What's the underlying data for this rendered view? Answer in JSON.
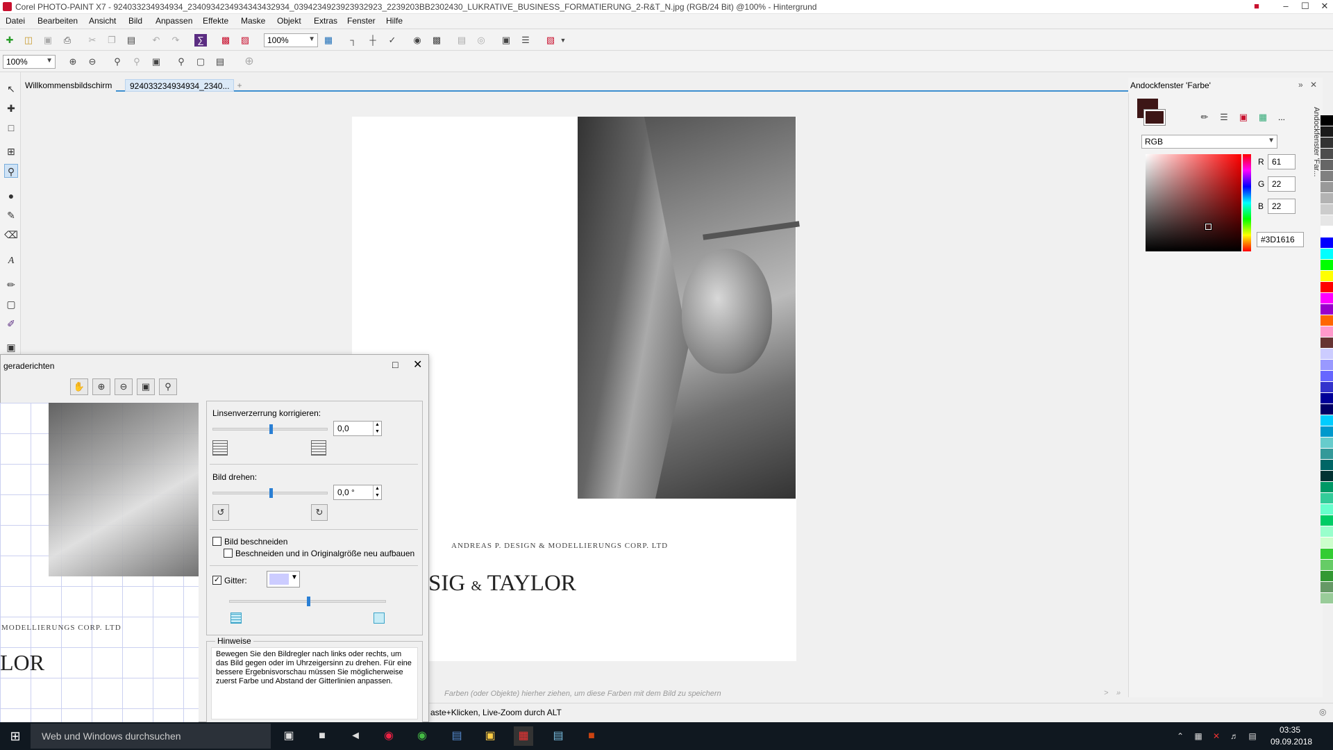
{
  "window": {
    "title": "Corel PHOTO-PAINT X7 - 924033234934934_2340934234934343432934_0394234923923932923_2239203BB2302430_LUKRATIVE_BUSINESS_FORMATIERUNG_2-R&T_N.jpg (RGB/24 Bit) @100% - Hintergrund",
    "min": "–",
    "max": "☐",
    "close": "✕"
  },
  "menu": [
    "Datei",
    "Bearbeiten",
    "Ansicht",
    "Bild",
    "Anpassen",
    "Effekte",
    "Maske",
    "Objekt",
    "Extras",
    "Fenster",
    "Hilfe"
  ],
  "toolbar": {
    "zoom_value": "100%"
  },
  "toolbar2": {
    "zoom_value": "100%"
  },
  "tabs": [
    {
      "label": "Willkommensbildschirm"
    },
    {
      "label": "924033234934934_2340..."
    }
  ],
  "canvas": {
    "company_line": "ANDREAS P. DESIGN & MODELLIERUNGS CORP. LTD",
    "logo_text": "SIG",
    "logo_amp": "&",
    "logo_name": "TAYLOR"
  },
  "dock": {
    "title": "Andockfenster 'Farbe'",
    "side_tab": "Andockfenster 'Far...",
    "model": "RGB",
    "r_label": "R",
    "r_value": "61",
    "g_label": "G",
    "g_value": "22",
    "b_label": "B",
    "b_value": "22",
    "hex": "#3D1616",
    "more": "...",
    "color": "#3D1616"
  },
  "palette": [
    "#000000",
    "#1a1a1a",
    "#333333",
    "#4d4d4d",
    "#666666",
    "#808080",
    "#999999",
    "#b3b3b3",
    "#cccccc",
    "#e6e6e6",
    "#ffffff",
    "#0000ff",
    "#00ffff",
    "#00ff00",
    "#ffff00",
    "#ff0000",
    "#ff00ff",
    "#9900cc",
    "#ff6600",
    "#ff99cc",
    "#663333",
    "#ccccff",
    "#9999ff",
    "#6666ff",
    "#3333cc",
    "#000099",
    "#000066",
    "#00ccff",
    "#0099cc",
    "#66cccc",
    "#339999",
    "#006666",
    "#003333",
    "#009966",
    "#33cc99",
    "#66ffcc",
    "#00cc66",
    "#99ffcc",
    "#ccffcc",
    "#33cc33",
    "#66cc66",
    "#339933",
    "#669966",
    "#99cc99"
  ],
  "swatch_hint": "Farben (oder Objekte) hierher ziehen, um diese Farben mit dem Bild zu speichern",
  "status": {
    "hint": "aste+Klicken, Live-Zoom durch ALT"
  },
  "dialog": {
    "title": "geraderichten",
    "lens_label": "Linsenverzerrung korrigieren:",
    "lens_value": "0,0",
    "lens_slider": 0.5,
    "rotate_label": "Bild drehen:",
    "rotate_value": "0,0 °",
    "rotate_slider": 0.5,
    "crop_label": "Bild beschneiden",
    "crop_checked": false,
    "crop_orig_label": "Beschneiden und in Originalgröße neu aufbauen",
    "crop_orig_checked": false,
    "grid_label": "Gitter:",
    "grid_checked": true,
    "grid_color": "#ccccff",
    "grid_slider": 0.5,
    "hints_title": "Hinweise",
    "hints_text": "Bewegen Sie den Bildregler nach links oder rechts, um das Bild gegen oder im Uhrzeigersinn zu drehen. Für eine bessere Ergebnisvorschau müssen Sie möglicherweise zuerst Farbe und Abstand der Gitterlinien anpassen.",
    "preview_company": "MODELLIERUNGS CORP. LTD",
    "preview_logo": "LOR"
  },
  "taskbar": {
    "search_placeholder": "Web und Windows durchsuchen",
    "time": "03:35",
    "date": "09.09.2018"
  }
}
